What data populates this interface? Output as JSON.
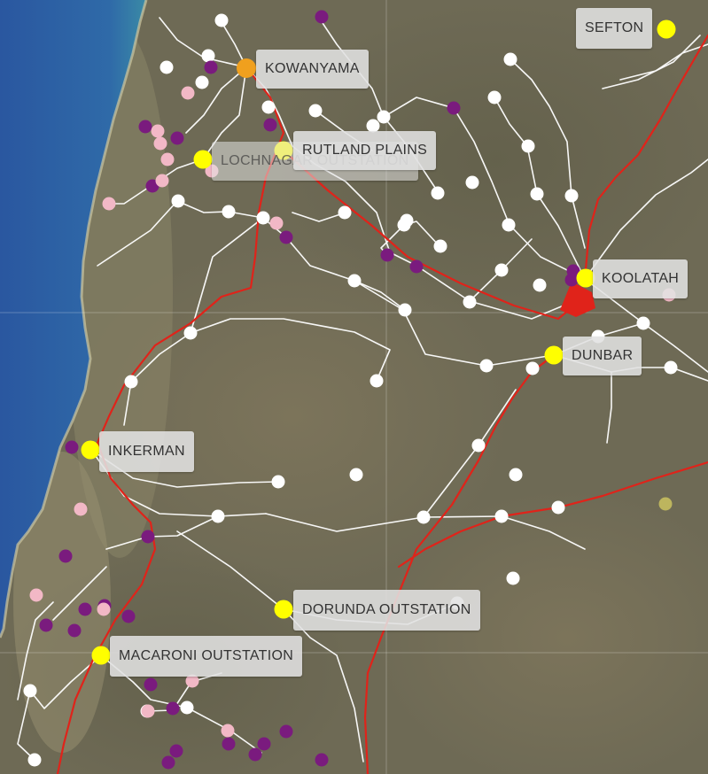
{
  "map": {
    "places": [
      {
        "name": "SEFTON",
        "point_color": "#ffff00"
      },
      {
        "name": "KOWANYAMA",
        "point_color": "#f0a01e"
      },
      {
        "name": "RUTLAND PLAINS",
        "point_color": "#ffff00"
      },
      {
        "name": "LOCHNAGAR OUTSTATION",
        "point_color": "#ffff00"
      },
      {
        "name": "KOOLATAH",
        "point_color": "#ffff00"
      },
      {
        "name": "DUNBAR",
        "point_color": "#ffff00"
      },
      {
        "name": "INKERMAN",
        "point_color": "#ffff00"
      },
      {
        "name": "DORUNDA OUTSTATION",
        "point_color": "#ffff00"
      },
      {
        "name": "MACARONI OUTSTATION",
        "point_color": "#ffff00"
      }
    ],
    "colors": {
      "ocean": "#2f63a6",
      "land": "#6e6a55",
      "road_major": "#e0231a",
      "road_minor": "#ffffff",
      "point_white": "#ffffff",
      "point_purple": "#7a1b7e",
      "point_pink": "#f2b8c6",
      "point_yellow": "#ffff00",
      "point_orange": "#f0a01e",
      "point_olive": "#bdb55e"
    }
  }
}
